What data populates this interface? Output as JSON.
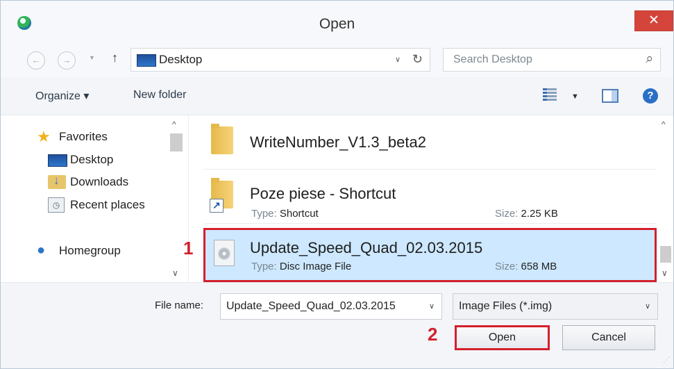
{
  "window": {
    "title": "Open",
    "close_glyph": "✕"
  },
  "nav": {
    "back_glyph": "←",
    "forward_glyph": "→",
    "recent_glyph": "▼",
    "up_glyph": "↑",
    "address": "Desktop",
    "address_dropdown_glyph": "∨",
    "refresh_glyph": "↻",
    "search_placeholder": "Search Desktop",
    "search_glyph": "⌕"
  },
  "toolbar": {
    "organize": "Organize ▾",
    "new_folder": "New folder",
    "views_dropdown_glyph": "▼",
    "help_glyph": "?"
  },
  "navpane": {
    "items": [
      {
        "label": "Favorites",
        "icon": "star-icon"
      },
      {
        "label": "Desktop",
        "icon": "desktop-icon"
      },
      {
        "label": "Downloads",
        "icon": "downloads-icon"
      },
      {
        "label": "Recent places",
        "icon": "recent-places-icon"
      },
      {
        "label": "Homegroup",
        "icon": "homegroup-icon"
      }
    ],
    "scroll_up_glyph": "^",
    "scroll_down_glyph": "∨"
  },
  "files": [
    {
      "name": "WriteNumber_V1.3_beta2",
      "icon": "folder-icon"
    },
    {
      "name": "Poze piese - Shortcut",
      "type_label": "Type:",
      "type": "Shortcut",
      "size_label": "Size:",
      "size": "2.25 KB",
      "icon": "shortcut-folder-icon"
    },
    {
      "name": "Update_Speed_Quad_02.03.2015",
      "type_label": "Type:",
      "type": "Disc Image File",
      "size_label": "Size:",
      "size": "658 MB",
      "icon": "disc-image-icon",
      "selected": true
    }
  ],
  "filepane": {
    "scroll_up_glyph": "^",
    "scroll_down_glyph": "∨"
  },
  "annotations": {
    "step1": "1",
    "step2": "2"
  },
  "bottom": {
    "file_name_label": "File name:",
    "file_name_value": "Update_Speed_Quad_02.03.2015",
    "file_name_dropdown_glyph": "∨",
    "filter": "Image Files (*.img)",
    "filter_dropdown_glyph": "∨",
    "open_button": "Open",
    "cancel_button": "Cancel",
    "grip_glyph": "⋰"
  },
  "colors": {
    "accent_red": "#d41f2c",
    "selection": "#cde8ff",
    "close_button": "#d5443b"
  }
}
